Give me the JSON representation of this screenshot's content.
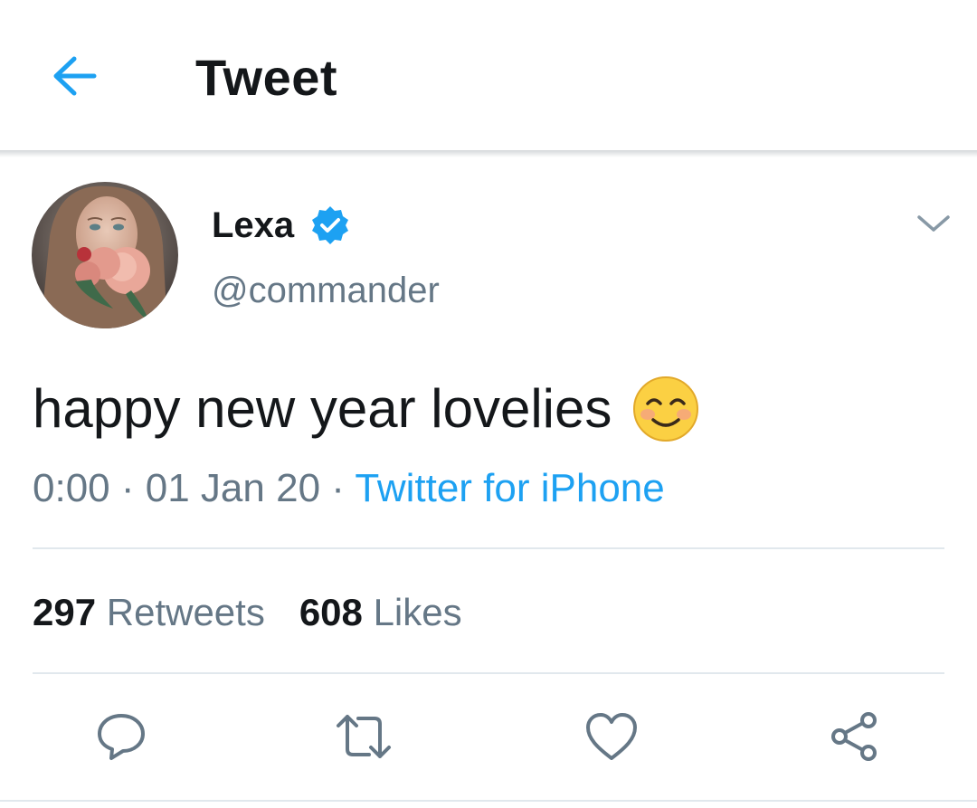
{
  "header": {
    "title": "Tweet",
    "back_icon": "arrow-left-icon"
  },
  "author": {
    "display_name": "Lexa",
    "handle": "@commander",
    "verified_icon": "verified-badge-icon",
    "menu_icon": "chevron-down-icon"
  },
  "tweet": {
    "text": "happy new year lovelies",
    "emoji_icon": "smiling-face-emoji-icon",
    "time": "0:00",
    "separator": "·",
    "date": "01 Jan 20",
    "source": "Twitter for iPhone"
  },
  "stats": {
    "retweets_count": "297",
    "retweets_label": "Retweets",
    "likes_count": "608",
    "likes_label": "Likes"
  },
  "actions": [
    {
      "icon": "reply-icon"
    },
    {
      "icon": "retweet-icon"
    },
    {
      "icon": "heart-icon"
    },
    {
      "icon": "share-icon"
    }
  ],
  "colors": {
    "accent": "#1da1f2",
    "text": "#14171a",
    "secondary_text": "#657786",
    "divider": "#e1e8ed",
    "icon": "#657786"
  }
}
